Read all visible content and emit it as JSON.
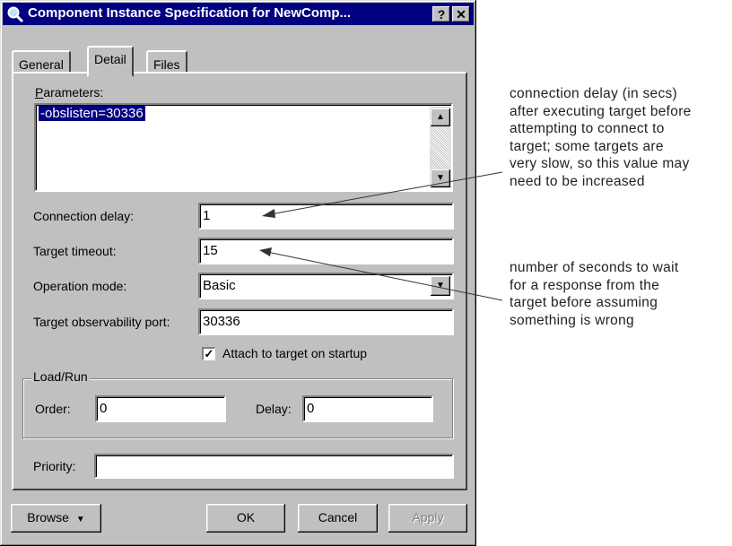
{
  "window": {
    "title": "Component Instance Specification for NewComp...",
    "help_button": "?",
    "close_button": "✕"
  },
  "tabs": [
    {
      "label": "General"
    },
    {
      "label": "Detail"
    },
    {
      "label": "Files"
    }
  ],
  "active_tab": "Detail",
  "parameters": {
    "label": "Parameters:",
    "value": "-obslisten=30336"
  },
  "fields": {
    "connection_delay": {
      "label": "Connection delay:",
      "value": "1"
    },
    "target_timeout": {
      "label": "Target timeout:",
      "value": "15"
    },
    "operation_mode": {
      "label": "Operation mode:",
      "value": "Basic"
    },
    "observability_port": {
      "label": "Target observability port:",
      "value": "30336"
    },
    "attach_checkbox": {
      "label": "Attach to target on startup",
      "checked": true
    },
    "priority": {
      "label": "Priority:",
      "value": ""
    }
  },
  "load_run": {
    "title": "Load/Run",
    "order_label": "Order:",
    "order_value": "0",
    "delay_label": "Delay:",
    "delay_value": "0"
  },
  "buttons": {
    "browse": "Browse",
    "ok": "OK",
    "cancel": "Cancel",
    "apply": "Apply"
  },
  "annotations": {
    "connection_delay_note": [
      "connection delay (in secs)",
      "after executing target before",
      "attempting to connect to",
      "target; some targets are",
      "very slow, so this value may",
      "need to be increased"
    ],
    "timeout_note": [
      "number of seconds to wait",
      "for a response from the",
      "target before assuming",
      "something is wrong"
    ]
  },
  "colors": {
    "titlebar": "#000080",
    "dialog": "#c0c0c0",
    "selection": "#000080"
  }
}
